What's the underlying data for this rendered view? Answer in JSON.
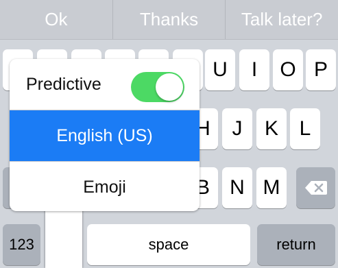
{
  "suggestions": [
    "Ok",
    "Thanks",
    "Talk later?"
  ],
  "keyboard": {
    "row1_visible": [
      "U",
      "I",
      "O",
      "P"
    ],
    "row2_visible": [
      "H",
      "J",
      "K",
      "L"
    ],
    "row3_visible": [
      "B",
      "N",
      "M"
    ],
    "numbers_label": "123",
    "space_label": "space",
    "return_label": "return",
    "delete_icon": "backspace-icon"
  },
  "popup": {
    "predictive_label": "Predictive",
    "predictive_enabled": true,
    "english_label": "English (US)",
    "emoji_label": "Emoji"
  },
  "colors": {
    "toggle_on": "#4cd964",
    "selected_row": "#1b7cf5",
    "keyboard_bg": "#d1d5db",
    "suggest_bg": "#c9ccd2"
  }
}
